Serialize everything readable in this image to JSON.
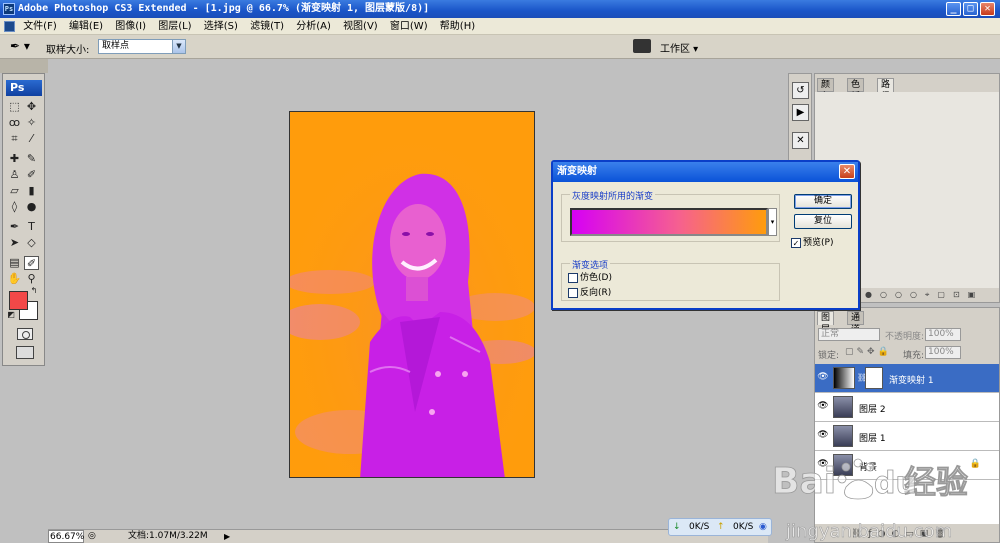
{
  "window": {
    "title": "Adobe Photoshop CS3 Extended - [1.jpg @ 66.7% (渐变映射 1, 图层蒙版/8)]",
    "min": "_",
    "max": "□",
    "close": "✕"
  },
  "menu": [
    "文件(F)",
    "编辑(E)",
    "图像(I)",
    "图层(L)",
    "选择(S)",
    "滤镜(T)",
    "分析(A)",
    "视图(V)",
    "窗口(W)",
    "帮助(H)"
  ],
  "options": {
    "sample_size_label": "取样大小:",
    "sample_size_value": "取样点",
    "workspace_label": "工作区 ▾"
  },
  "tools": {
    "logo": "Ps"
  },
  "status": {
    "zoom": "66.67%",
    "doc": "文档:1.07M/3.22M",
    "net_down": "0K/S",
    "net_up": "0K/S"
  },
  "panel_top": {
    "tabs": [
      "颜色",
      "色板",
      "路径"
    ],
    "active_tab": 2,
    "close_x": "×"
  },
  "layers_panel": {
    "tabs": [
      "图层",
      "通道"
    ],
    "blend_mode": "正常",
    "opacity_label": "不透明度:",
    "opacity": "100%",
    "lock_label": "锁定:",
    "fill_label": "填充:",
    "fill": "100%",
    "layers": [
      {
        "name": "渐变映射 1",
        "type": "adjustment",
        "active": true
      },
      {
        "name": "图层 2",
        "type": "pixel",
        "active": false
      },
      {
        "name": "图层 1",
        "type": "pixel",
        "active": false
      },
      {
        "name": "背景",
        "type": "background",
        "active": false
      }
    ]
  },
  "dialog": {
    "title": "渐变映射",
    "group_gradient": "灰度映射所用的渐变",
    "group_options": "渐变选项",
    "dither": "仿色(D)",
    "reverse": "反向(R)",
    "ok": "确定",
    "reset": "复位",
    "preview": "预览(P)",
    "preview_checked": true,
    "gradient_colors": [
      "#d600f5",
      "#f66090",
      "#ff9c0c"
    ]
  },
  "watermark": {
    "brand": "Baidu",
    "cn": "经验",
    "url": "jingyan.baidu.com"
  },
  "colors": {
    "foreground": "#f24848",
    "background": "#ffffff",
    "image_orange": "#ff9c0c",
    "image_magenta": "#d830e8",
    "selection_blue": "#3a6cc4"
  }
}
